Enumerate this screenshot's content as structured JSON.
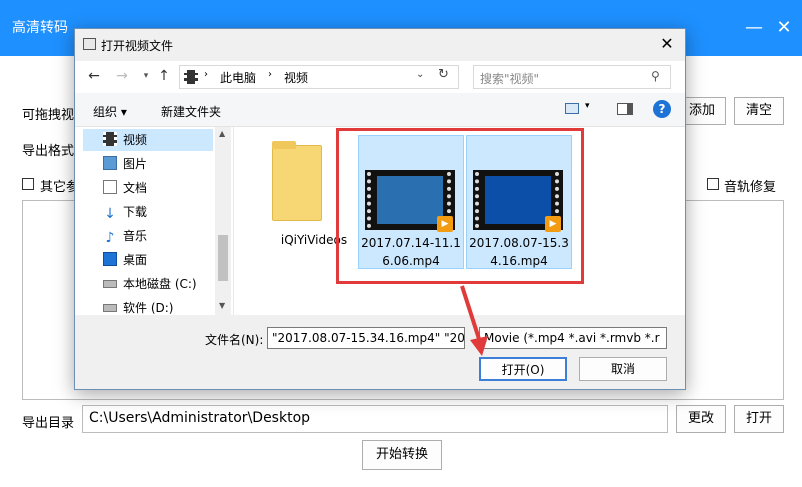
{
  "app": {
    "title": "高清转码",
    "minimize": "—",
    "close": "✕",
    "drag_label": "可拖拽视",
    "export_format_label": "导出格式",
    "other_label": "其它参",
    "audio_fix_label": "音轨修复",
    "add_button": "添加",
    "clear_button": "清空",
    "output_dir_label": "导出目录",
    "output_dir_value": "C:\\Users\\Administrator\\Desktop",
    "change_button": "更改",
    "open_dir_button": "打开",
    "start_button": "开始转换"
  },
  "dialog": {
    "title": "打开视频文件",
    "close": "✕",
    "breadcrumb": [
      "此电脑",
      "视频"
    ],
    "search_placeholder": "搜索\"视频\"",
    "organize": "组织 ▾",
    "new_folder": "新建文件夹",
    "nav_items": [
      {
        "label": "视频",
        "icon": "video-folder-icon",
        "selected": true
      },
      {
        "label": "图片",
        "icon": "pictures-icon"
      },
      {
        "label": "文档",
        "icon": "documents-icon"
      },
      {
        "label": "下载",
        "icon": "download-icon"
      },
      {
        "label": "音乐",
        "icon": "music-icon"
      },
      {
        "label": "桌面",
        "icon": "desktop-icon"
      },
      {
        "label": "本地磁盘 (C:)",
        "icon": "drive-icon"
      },
      {
        "label": "软件 (D:)",
        "icon": "drive-icon"
      }
    ],
    "files": [
      {
        "name": "iQiYiVideos",
        "type": "folder"
      },
      {
        "name": "2017.07.14-11.16.06.mp4",
        "type": "video",
        "selected": true
      },
      {
        "name": "2017.08.07-15.34.16.mp4",
        "type": "video",
        "selected": true
      }
    ],
    "filename_label": "文件名(N):",
    "filename_value": "\"2017.08.07-15.34.16.mp4\" \"20",
    "filetype_value": "Movie (*.mp4 *.avi *.rmvb *.r",
    "open_button": "打开(O)",
    "cancel_button": "取消"
  },
  "colors": {
    "titlebar": "#1e90ff",
    "highlight": "#e03a3a",
    "selection": "#cce8ff"
  }
}
